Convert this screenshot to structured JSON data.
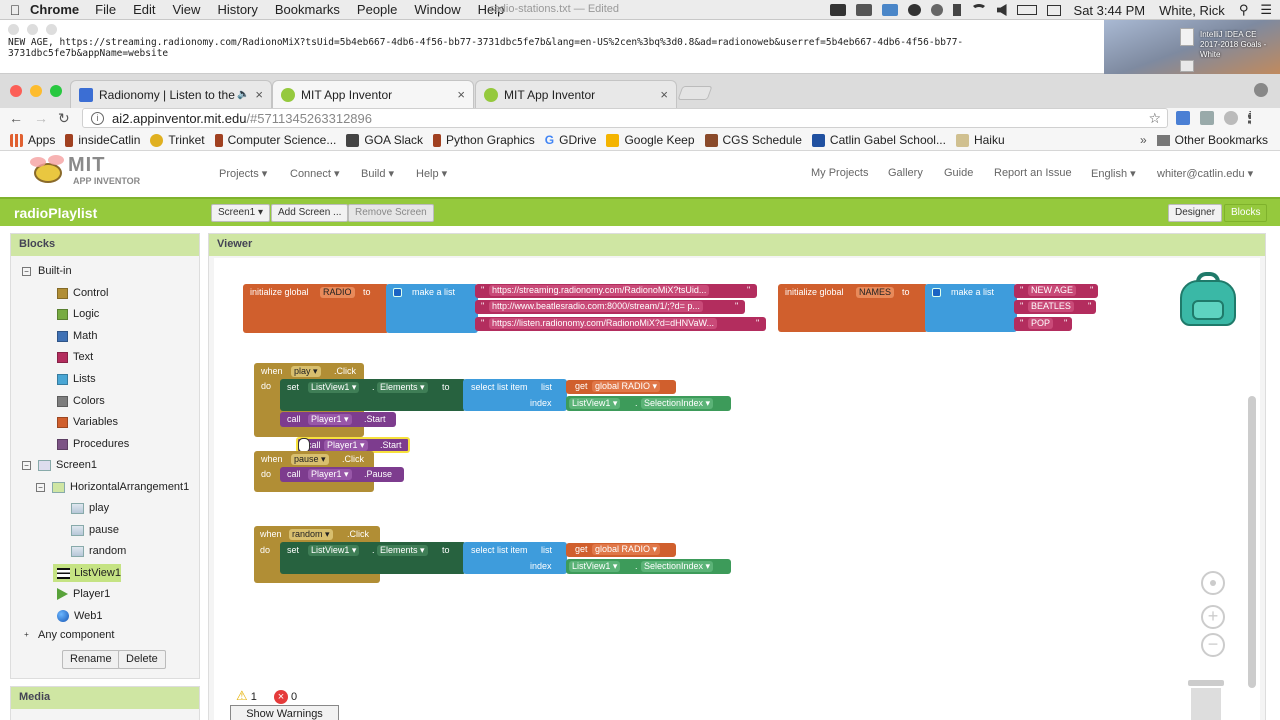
{
  "menubar": {
    "app": "Chrome",
    "items": [
      "File",
      "Edit",
      "View",
      "History",
      "Bookmarks",
      "People",
      "Window",
      "Help"
    ],
    "doc_title": "radio-stations.txt — Edited",
    "clock": "Sat 3:44 PM",
    "user": "White, Rick"
  },
  "textwin": {
    "content": "NEW AGE, https://streaming.radionomy.com/RadionoMiX?tsUid=5b4eb667-4db6-4f56-bb77-3731dbc5fe7b&lang=en-US%2cen%3bq%3d0.8&ad=radionoweb&userref=5b4eb667-4db6-4f56-bb77-3731dbc5fe7b&appName=website"
  },
  "desktop": {
    "label1": "IntelliJ IDEA CE",
    "label2": "2017-2018 Goals - White"
  },
  "tabs": [
    {
      "label": "Radionomy | Listen to the b",
      "color": "#3b6ed4"
    },
    {
      "label": "MIT App Inventor",
      "color": "#95c93d"
    },
    {
      "label": "MIT App Inventor",
      "color": "#95c93d"
    }
  ],
  "address": {
    "host": "ai2.appinventor.mit.edu",
    "path": "/#5711345263312896"
  },
  "bookmarks": [
    {
      "label": "Apps",
      "color": "#e06030"
    },
    {
      "label": "insideCatlin",
      "color": "#a04020"
    },
    {
      "label": "Trinket",
      "color": "#e0b020"
    },
    {
      "label": "Computer Science...",
      "color": "#a04020"
    },
    {
      "label": "GOA Slack",
      "color": "#444444"
    },
    {
      "label": "Python Graphics",
      "color": "#a04020"
    },
    {
      "label": "GDrive",
      "color": "#4285f4"
    },
    {
      "label": "Google Keep",
      "color": "#f4b400"
    },
    {
      "label": "CGS Schedule",
      "color": "#8a4a2a"
    },
    {
      "label": "Catlin Gabel School...",
      "color": "#2050a0"
    },
    {
      "label": "Haiku",
      "color": "#d0c090"
    }
  ],
  "bookmarks_right": "Other Bookmarks",
  "ai": {
    "logo": "MIT",
    "logo_sub": "APP INVENTOR",
    "menu_left": [
      "Projects ▾",
      "Connect ▾",
      "Build ▾",
      "Help ▾"
    ],
    "menu_right": [
      "My Projects",
      "Gallery",
      "Guide",
      "Report an Issue",
      "English ▾",
      "whiter@catlin.edu ▾"
    ]
  },
  "project": {
    "name": "radioPlaylist",
    "screen_btn": "Screen1 ▾",
    "add_screen": "Add Screen ...",
    "remove_screen": "Remove Screen",
    "designer": "Designer",
    "blocks": "Blocks"
  },
  "blocks_panel": {
    "title": "Blocks",
    "builtin": "Built-in",
    "builtin_items": [
      {
        "label": "Control",
        "color": "#b18e35"
      },
      {
        "label": "Logic",
        "color": "#77ab41"
      },
      {
        "label": "Math",
        "color": "#3f71b5"
      },
      {
        "label": "Text",
        "color": "#b32d5e"
      },
      {
        "label": "Lists",
        "color": "#49a6d4"
      },
      {
        "label": "Colors",
        "color": "#7d7d7d"
      },
      {
        "label": "Variables",
        "color": "#d05f2d"
      },
      {
        "label": "Procedures",
        "color": "#7c5385"
      }
    ],
    "screen": "Screen1",
    "arrangement": "HorizontalArrangement1",
    "buttons": [
      "play",
      "pause",
      "random"
    ],
    "listview": "ListView1",
    "player": "Player1",
    "web": "Web1",
    "any": "Any component",
    "rename": "Rename",
    "delete": "Delete"
  },
  "media_panel": {
    "title": "Media"
  },
  "viewer": {
    "title": "Viewer"
  },
  "blocks": {
    "init_radio": "initialize global",
    "radio_name": "RADIO",
    "to": "to",
    "make_list": "make a list",
    "radio_urls": [
      "https://streaming.radionomy.com/RadionoMiX?tsUid...",
      "http://www.beatlesradio.com:8000/stream/1/;?d= p...",
      "https://listen.radionomy.com/RadionoMiX?d=dHNVaW..."
    ],
    "names_name": "NAMES",
    "names": [
      "NEW AGE",
      "BEATLES",
      "POP"
    ],
    "when": "when",
    "do": "do",
    "play": "play",
    "pause": "pause",
    "random": "random",
    "click": ".Click",
    "set": "set",
    "listview": "ListView1",
    "elements": "Elements",
    "select_item": "select list item",
    "list": "list",
    "index": "index",
    "get": "get",
    "global_radio": "global RADIO",
    "selection_index": "SelectionIndex",
    "call": "call",
    "player": "Player1",
    "start": ".Start",
    "pause_method": ".Pause"
  },
  "warnings": {
    "warn_count": "1",
    "error_count": "0",
    "show": "Show Warnings"
  }
}
